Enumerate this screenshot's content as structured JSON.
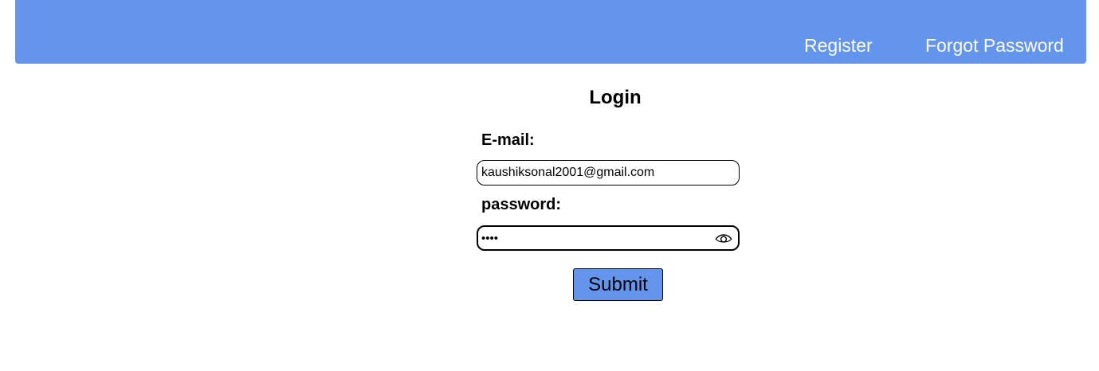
{
  "nav": {
    "register_label": "Register",
    "forgot_label": "Forgot Password"
  },
  "form": {
    "title": "Login",
    "email_label": "E-mail:",
    "email_value": "kaushiksonal2001@gmail.com",
    "password_label": "password:",
    "password_value": "••••",
    "submit_label": "Submit",
    "show_password_icon": "eye-icon"
  },
  "colors": {
    "accent": "#6495ed",
    "nav_text": "#ffffff"
  }
}
